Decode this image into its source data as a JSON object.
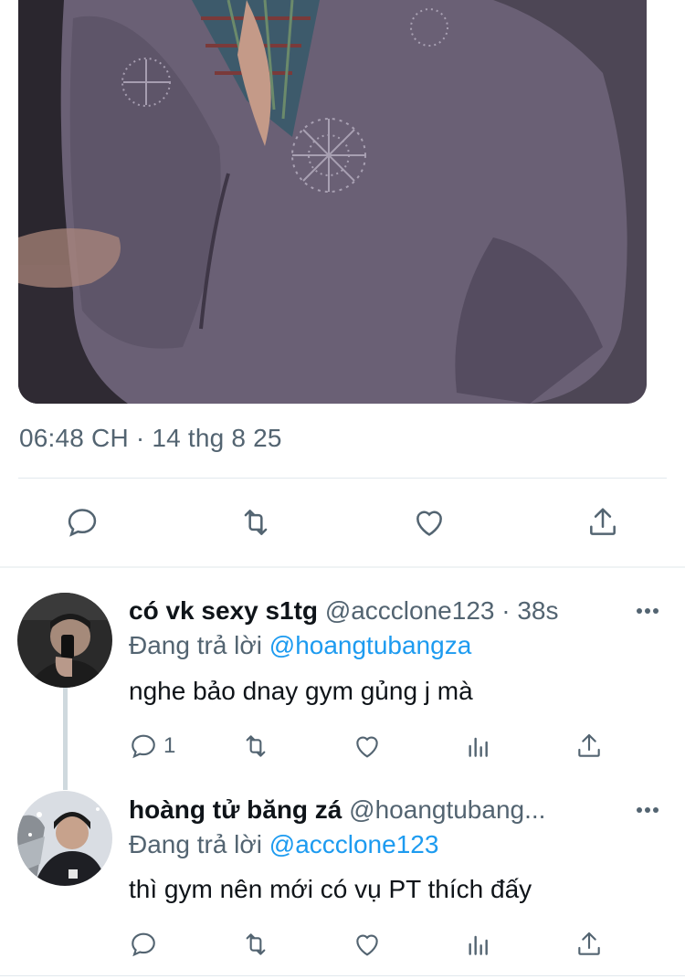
{
  "main_tweet": {
    "image_icon": "photo-image",
    "timestamp": "06:48 CH · 14 thg 8 25",
    "actions": [
      "reply-icon",
      "retweet-icon",
      "like-icon",
      "share-icon"
    ]
  },
  "replies": [
    {
      "name": "có vk sexy s1tg",
      "handle": "@accclone123 · 38s",
      "replying_prefix": "Đang trả lời ",
      "replying_to": "@hoangtubangza",
      "text": "nghe bảo dnay gym gủng j mà",
      "reply_count": "1",
      "actions": [
        "reply-icon",
        "retweet-icon",
        "like-icon",
        "analytics-icon",
        "share-icon"
      ]
    },
    {
      "name": "hoàng tử băng zá",
      "handle": "@hoangtubang...",
      "replying_prefix": "Đang trả lời ",
      "replying_to": "@accclone123",
      "text": "thì gym nên mới có vụ PT thích đấy",
      "reply_count": "",
      "actions": [
        "reply-icon",
        "retweet-icon",
        "like-icon",
        "analytics-icon",
        "share-icon"
      ]
    }
  ],
  "colors": {
    "text_primary": "#0f1419",
    "text_secondary": "#536471",
    "link": "#1d9bf0",
    "divider": "#e1e8ed"
  }
}
